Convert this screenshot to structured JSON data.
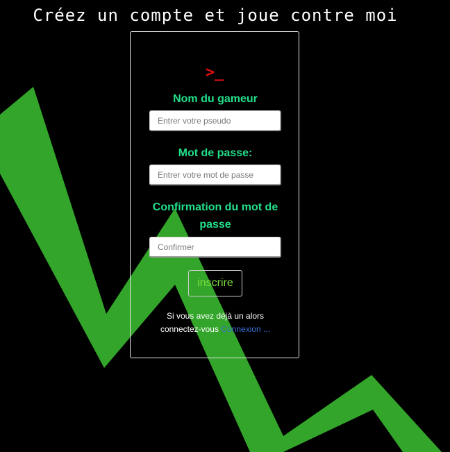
{
  "page": {
    "title": "Créez un compte et joue contre moi"
  },
  "logo": {
    "icon": "terminal-prompt-icon",
    "glyph": ">_"
  },
  "form": {
    "username": {
      "label": "Nom du gameur",
      "placeholder": "Entrer votre pseudo",
      "value": ""
    },
    "password": {
      "label": "Mot de passe:",
      "placeholder": "Entrer votre mot de passe",
      "value": ""
    },
    "confirm": {
      "label": "Confirmation du mot de passe",
      "placeholder": "Confirmer",
      "value": ""
    },
    "submit_label": "inscrire"
  },
  "login_prompt": {
    "text_line1": "Si vous avez déjà un alors",
    "text_line2": "connectez-vous",
    "link_label": "Connexion ..."
  },
  "colors": {
    "background": "#000000",
    "zigzag": "#33a52a",
    "label_green": "#22e08a",
    "button_text": "#7fe03c",
    "logo_red": "#e01010",
    "link_blue": "#3a6fd8"
  }
}
